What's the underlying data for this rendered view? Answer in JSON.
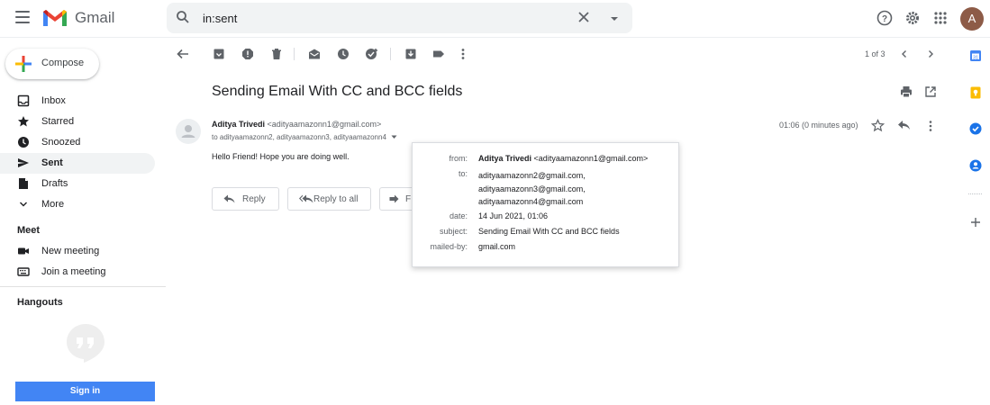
{
  "app": {
    "name": "Gmail"
  },
  "search": {
    "value": "in:sent"
  },
  "user": {
    "avatar_letter": "A"
  },
  "colors": {
    "accent": "#4285f4",
    "avatar_bg": "#8d5b47",
    "active_nav": "#f1f3f4"
  },
  "sidebar": {
    "compose_label": "Compose",
    "items": [
      {
        "label": "Inbox",
        "icon": "inbox-icon"
      },
      {
        "label": "Starred",
        "icon": "star-icon"
      },
      {
        "label": "Snoozed",
        "icon": "clock-icon"
      },
      {
        "label": "Sent",
        "icon": "send-icon"
      },
      {
        "label": "Drafts",
        "icon": "draft-icon"
      },
      {
        "label": "More",
        "icon": "chevron-down-icon"
      }
    ],
    "meet": {
      "title": "Meet",
      "items": [
        {
          "label": "New meeting",
          "icon": "video-icon"
        },
        {
          "label": "Join a meeting",
          "icon": "keyboard-icon"
        }
      ]
    },
    "hangouts": {
      "title": "Hangouts",
      "signin_label": "Sign in"
    }
  },
  "pager": {
    "text": "1 of 3"
  },
  "message": {
    "subject": "Sending Email With CC and BCC fields",
    "sender_name": "Aditya Trivedi",
    "sender_email": "<adityaamazonn1@gmail.com>",
    "to_line": "to adityaamazonn2, adityaamazonn3, adityaamazonn4",
    "time": "01:06 (0 minutes ago)",
    "body": "Hello Friend! Hope you are doing well."
  },
  "actions": {
    "reply": "Reply",
    "reply_all": "Reply to all",
    "forward_partial": "F"
  },
  "details": {
    "from_key": "from:",
    "from_name": "Aditya Trivedi",
    "from_email": "<adityaamazonn1@gmail.com>",
    "to_key": "to:",
    "to_values": [
      "adityaamazonn2@gmail.com,",
      "adityaamazonn3@gmail.com,",
      "adityaamazonn4@gmail.com"
    ],
    "date_key": "date:",
    "date_value": "14 Jun 2021, 01:06",
    "subject_key": "subject:",
    "subject_value": "Sending Email With CC and BCC fields",
    "mailedby_key": "mailed-by:",
    "mailedby_value": "gmail.com"
  }
}
